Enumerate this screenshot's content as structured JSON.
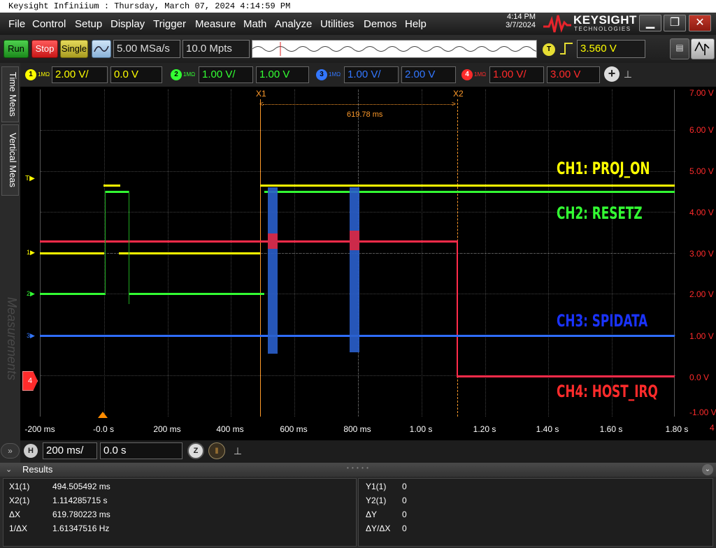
{
  "titlebar": {
    "text": "Keysight Infiniium : Thursday, March 07, 2024 4:14:59 PM"
  },
  "menu": {
    "items": [
      "File",
      "Control",
      "Setup",
      "Display",
      "Trigger",
      "Measure",
      "Math",
      "Analyze",
      "Utilities",
      "Demos",
      "Help"
    ],
    "time": "4:14 PM",
    "date": "3/7/2024",
    "brand": "KEYSIGHT",
    "brand_sub": "TECHNOLOGIES"
  },
  "toolbar": {
    "run": "Run",
    "stop": "Stop",
    "single": "Single",
    "sample_rate": "5.00 MSa/s",
    "memory_depth": "10.0 Mpts",
    "trigger_badge": "T",
    "trigger_level": "3.560 V"
  },
  "channels": [
    {
      "num": "1",
      "impedance": "1MΩ",
      "scale": "2.00 V/",
      "offset": "0.0 V",
      "color": "#ffff00"
    },
    {
      "num": "2",
      "impedance": "1MΩ",
      "scale": "1.00 V/",
      "offset": "1.00 V",
      "color": "#33ff33"
    },
    {
      "num": "3",
      "impedance": "1MΩ",
      "scale": "1.00 V/",
      "offset": "2.00 V",
      "color": "#3377ff"
    },
    {
      "num": "4",
      "impedance": "1MΩ",
      "scale": "1.00 V/",
      "offset": "3.00 V",
      "color": "#ff2b2b"
    }
  ],
  "sidetabs": {
    "time_meas": "Time Meas",
    "vertical_meas": "Vertical Meas",
    "measurements": "Measurements"
  },
  "plot": {
    "right_axis": [
      "7.00 V",
      "6.00 V",
      "5.00 V",
      "4.00 V",
      "3.00 V",
      "2.00 V",
      "1.00 V",
      "0.0 V",
      "-1.00 V"
    ],
    "bottom_axis": [
      "-200 ms",
      "-0.0 s",
      "200 ms",
      "400 ms",
      "600 ms",
      "800 ms",
      "1.00 s",
      "1.20 s",
      "1.40 s",
      "1.60 s",
      "1.80 s"
    ],
    "bottom_axis_trailing": "4",
    "x1_label": "X1",
    "x2_label": "X2",
    "delta_label": "619.78 ms",
    "trigger_marker": "T",
    "ch_markers": [
      "1",
      "2",
      "3",
      "4"
    ],
    "labels": {
      "ch1": "CH1: PROJ_ON",
      "ch2": "CH2: RESETZ",
      "ch3": "CH3: SPIDATA",
      "ch4": "CH4: HOST_IRQ"
    }
  },
  "horizontal": {
    "badge": "H",
    "scale": "200 ms/",
    "position": "0.0 s"
  },
  "results": {
    "title": "Results",
    "left": [
      {
        "label": "X1(1)",
        "value": "494.505492 ms"
      },
      {
        "label": "X2(1)",
        "value": "1.114285715 s"
      },
      {
        "label": "ΔX",
        "value": "619.780223 ms"
      },
      {
        "label": "1/ΔX",
        "value": "1.61347516 Hz"
      }
    ],
    "right": [
      {
        "label": "Y1(1)",
        "value": "0"
      },
      {
        "label": "Y2(1)",
        "value": "0"
      },
      {
        "label": "ΔY",
        "value": "0"
      },
      {
        "label": "ΔY/ΔX",
        "value": "0"
      }
    ]
  }
}
